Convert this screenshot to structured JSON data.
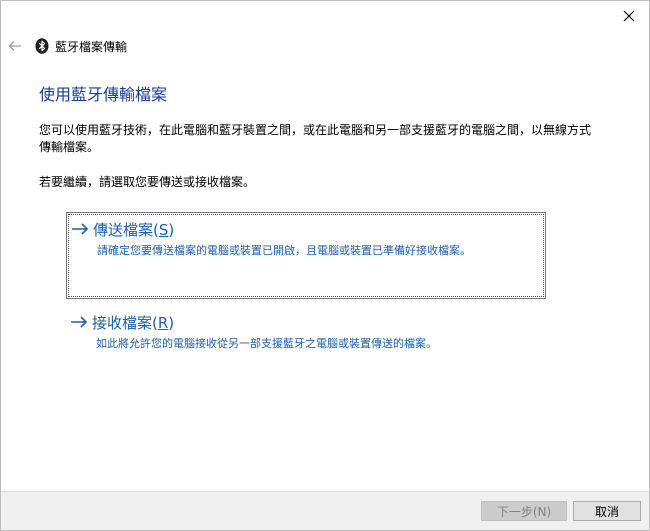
{
  "window": {
    "title": "藍牙檔案傳輸"
  },
  "colors": {
    "accent": "#1a5fb4",
    "heading": "#1a3d9a"
  },
  "icons": {
    "back": "back-arrow-icon",
    "bluetooth": "bluetooth-icon",
    "close": "close-icon",
    "option_arrow": "right-arrow-icon"
  },
  "main": {
    "heading": "使用藍牙傳輸檔案",
    "description": "您可以使用藍牙技術，在此電腦和藍牙裝置之間，或在此電腦和另一部支援藍牙的電腦之間，以無線方式傳輸檔案。",
    "instruction": "若要繼續，請選取您要傳送或接收檔案。"
  },
  "options": {
    "send": {
      "title": "傳送檔案(",
      "accel": "S",
      "title_end": ")",
      "subtitle": "請確定您要傳送檔案的電腦或裝置已開啟，且電腦或裝置已準備好接收檔案。"
    },
    "receive": {
      "title": "接收檔案(",
      "accel": "R",
      "title_end": ")",
      "subtitle": "如此將允許您的電腦接收從另一部支援藍牙之電腦或裝置傳送的檔案。"
    }
  },
  "footer": {
    "next_label": "下一步(N)",
    "cancel_label": "取消"
  }
}
